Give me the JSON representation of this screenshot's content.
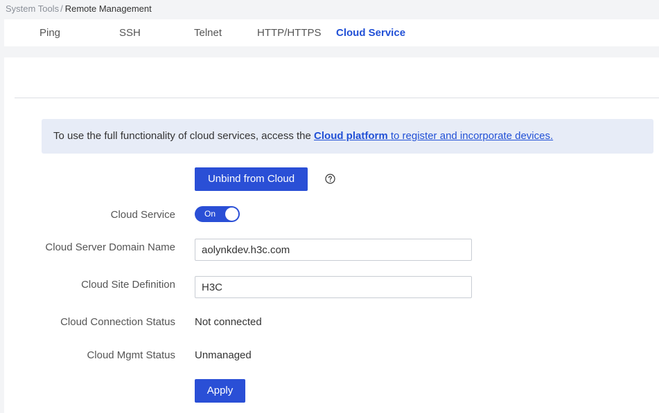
{
  "breadcrumb": {
    "parent": "System Tools",
    "separator": "/",
    "current": "Remote Management"
  },
  "tabs": [
    {
      "label": "Ping",
      "active": false
    },
    {
      "label": "SSH",
      "active": false
    },
    {
      "label": "Telnet",
      "active": false
    },
    {
      "label": "HTTP/HTTPS",
      "active": false
    },
    {
      "label": "Cloud Service",
      "active": true
    }
  ],
  "notice": {
    "before": "To use the full functionality of cloud services, access the ",
    "link": "Cloud platform ",
    "after": "to register and incorporate devices."
  },
  "unbind_button": "Unbind from Cloud",
  "help_icon": "question-circle-icon",
  "form": {
    "cloud_service": {
      "label": "Cloud Service",
      "toggle_text": "On",
      "enabled": true
    },
    "domain_name": {
      "label": "Cloud Server Domain Name",
      "value": "aolynkdev.h3c.com"
    },
    "site_definition": {
      "label": "Cloud Site Definition",
      "value": "H3C"
    },
    "connection_status": {
      "label": "Cloud Connection Status",
      "value": "Not connected"
    },
    "mgmt_status": {
      "label": "Cloud Mgmt Status",
      "value": "Unmanaged"
    }
  },
  "apply_button": "Apply",
  "colors": {
    "accent": "#2a4fd6",
    "active_tab": "#2150d6",
    "notice_bg": "#e7ecf7",
    "page_bg": "#f3f4f6"
  }
}
